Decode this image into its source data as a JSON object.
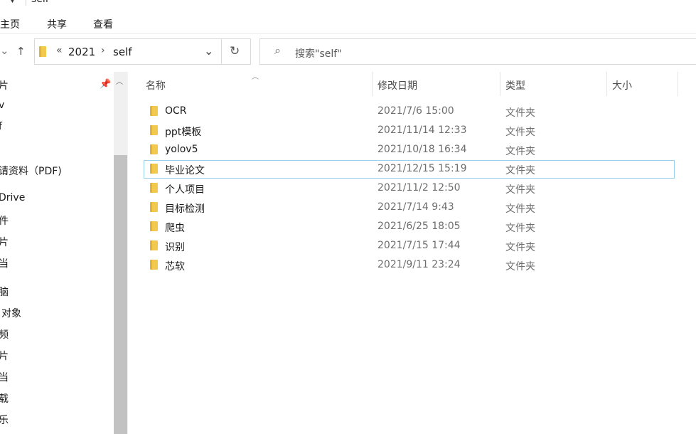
{
  "window": {
    "title": "self"
  },
  "ribbon": {
    "tabs": [
      "主页",
      "共享",
      "查看"
    ]
  },
  "address": {
    "crumb_sep": "«",
    "path": [
      "2021",
      "self"
    ],
    "arrow": "›"
  },
  "search": {
    "placeholder": "搜索\"self\""
  },
  "sidebar": {
    "items": [
      "片",
      "v",
      "f",
      "请资料（PDF)",
      "Drive",
      "件",
      "片",
      "当",
      "脑",
      "对象",
      "频",
      "片",
      "当",
      "载",
      "乐"
    ]
  },
  "columns": {
    "name": "名称",
    "date": "修改日期",
    "type": "类型",
    "size": "大小"
  },
  "files": [
    {
      "name": "OCR",
      "date": "2021/7/6 15:00",
      "type": "文件夹"
    },
    {
      "name": "ppt模板",
      "date": "2021/11/14 12:33",
      "type": "文件夹"
    },
    {
      "name": "yolov5",
      "date": "2021/10/18 16:34",
      "type": "文件夹"
    },
    {
      "name": "毕业论文",
      "date": "2021/12/15 15:19",
      "type": "文件夹"
    },
    {
      "name": "个人项目",
      "date": "2021/11/2 12:50",
      "type": "文件夹"
    },
    {
      "name": "目标检测",
      "date": "2021/7/14 9:43",
      "type": "文件夹"
    },
    {
      "name": "爬虫",
      "date": "2021/6/25 18:05",
      "type": "文件夹"
    },
    {
      "name": "识别",
      "date": "2021/7/15 17:44",
      "type": "文件夹"
    },
    {
      "name": "芯软",
      "date": "2021/9/11 23:24",
      "type": "文件夹"
    }
  ],
  "colors": {
    "folder": "#f2c94c",
    "selection_border": "#99d1ea",
    "scroll_thumb": "#c2c2c2"
  }
}
